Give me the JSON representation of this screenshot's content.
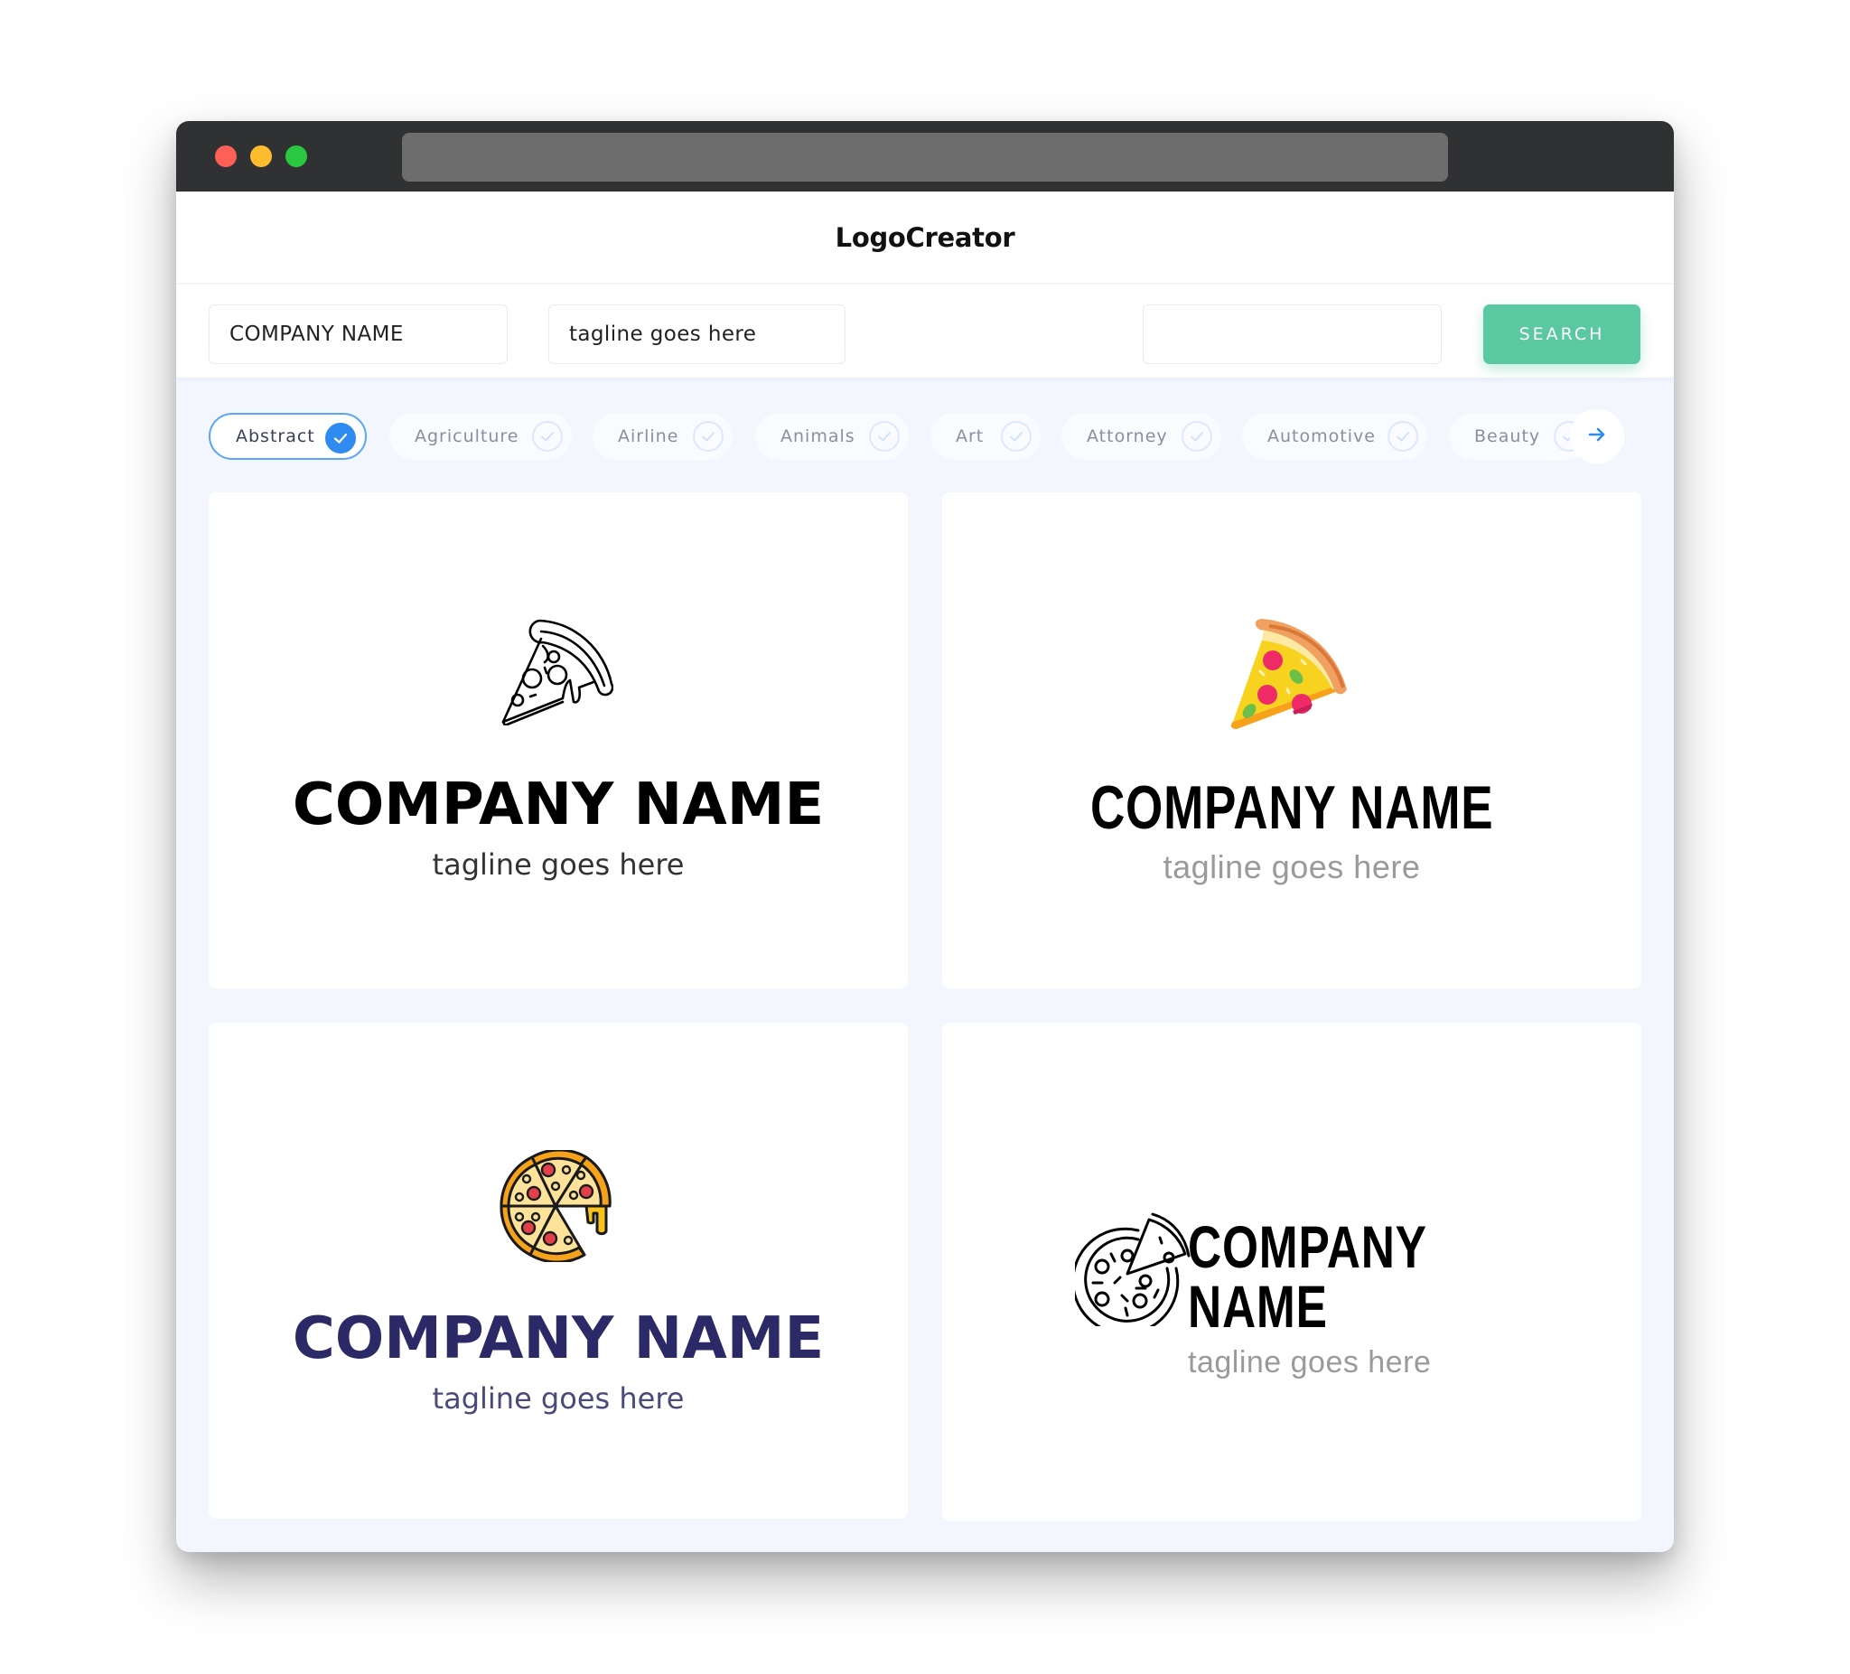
{
  "window": {
    "traffic_lights": [
      "close",
      "minimize",
      "maximize"
    ],
    "url": ""
  },
  "header": {
    "title": "LogoCreator"
  },
  "search": {
    "company_name_value": "COMPANY NAME",
    "tagline_value": "tagline goes here",
    "keyword_value": "",
    "button_label": "SEARCH",
    "button_color": "#5ac8a0"
  },
  "categories": {
    "items": [
      {
        "label": "Abstract",
        "selected": true
      },
      {
        "label": "Agriculture",
        "selected": false
      },
      {
        "label": "Airline",
        "selected": false
      },
      {
        "label": "Animals",
        "selected": false
      },
      {
        "label": "Art",
        "selected": false
      },
      {
        "label": "Attorney",
        "selected": false
      },
      {
        "label": "Automotive",
        "selected": false
      },
      {
        "label": "Beauty",
        "selected": false
      }
    ],
    "next_icon": "arrow-right-icon",
    "accent_color": "#2f8bf0"
  },
  "logos": [
    {
      "icon": "pizza-slice-outline-icon",
      "company_name": "COMPANY NAME",
      "tagline": "tagline goes here",
      "name_color": "#000000",
      "tagline_color": "#333333"
    },
    {
      "icon": "pizza-slice-flat-color-icon",
      "company_name": "COMPANY NAME",
      "tagline": "tagline goes here",
      "name_color": "#000000",
      "tagline_color": "#9a9a9a"
    },
    {
      "icon": "whole-pizza-color-icon",
      "company_name": "COMPANY NAME",
      "tagline": "tagline goes here",
      "name_color": "#2b2a66",
      "tagline_color": "#4a4a7a"
    },
    {
      "icon": "whole-pizza-outline-icon",
      "company_name": "COMPANY NAME",
      "tagline": "tagline goes here",
      "name_color": "#000000",
      "tagline_color": "#9a9a9a"
    }
  ]
}
